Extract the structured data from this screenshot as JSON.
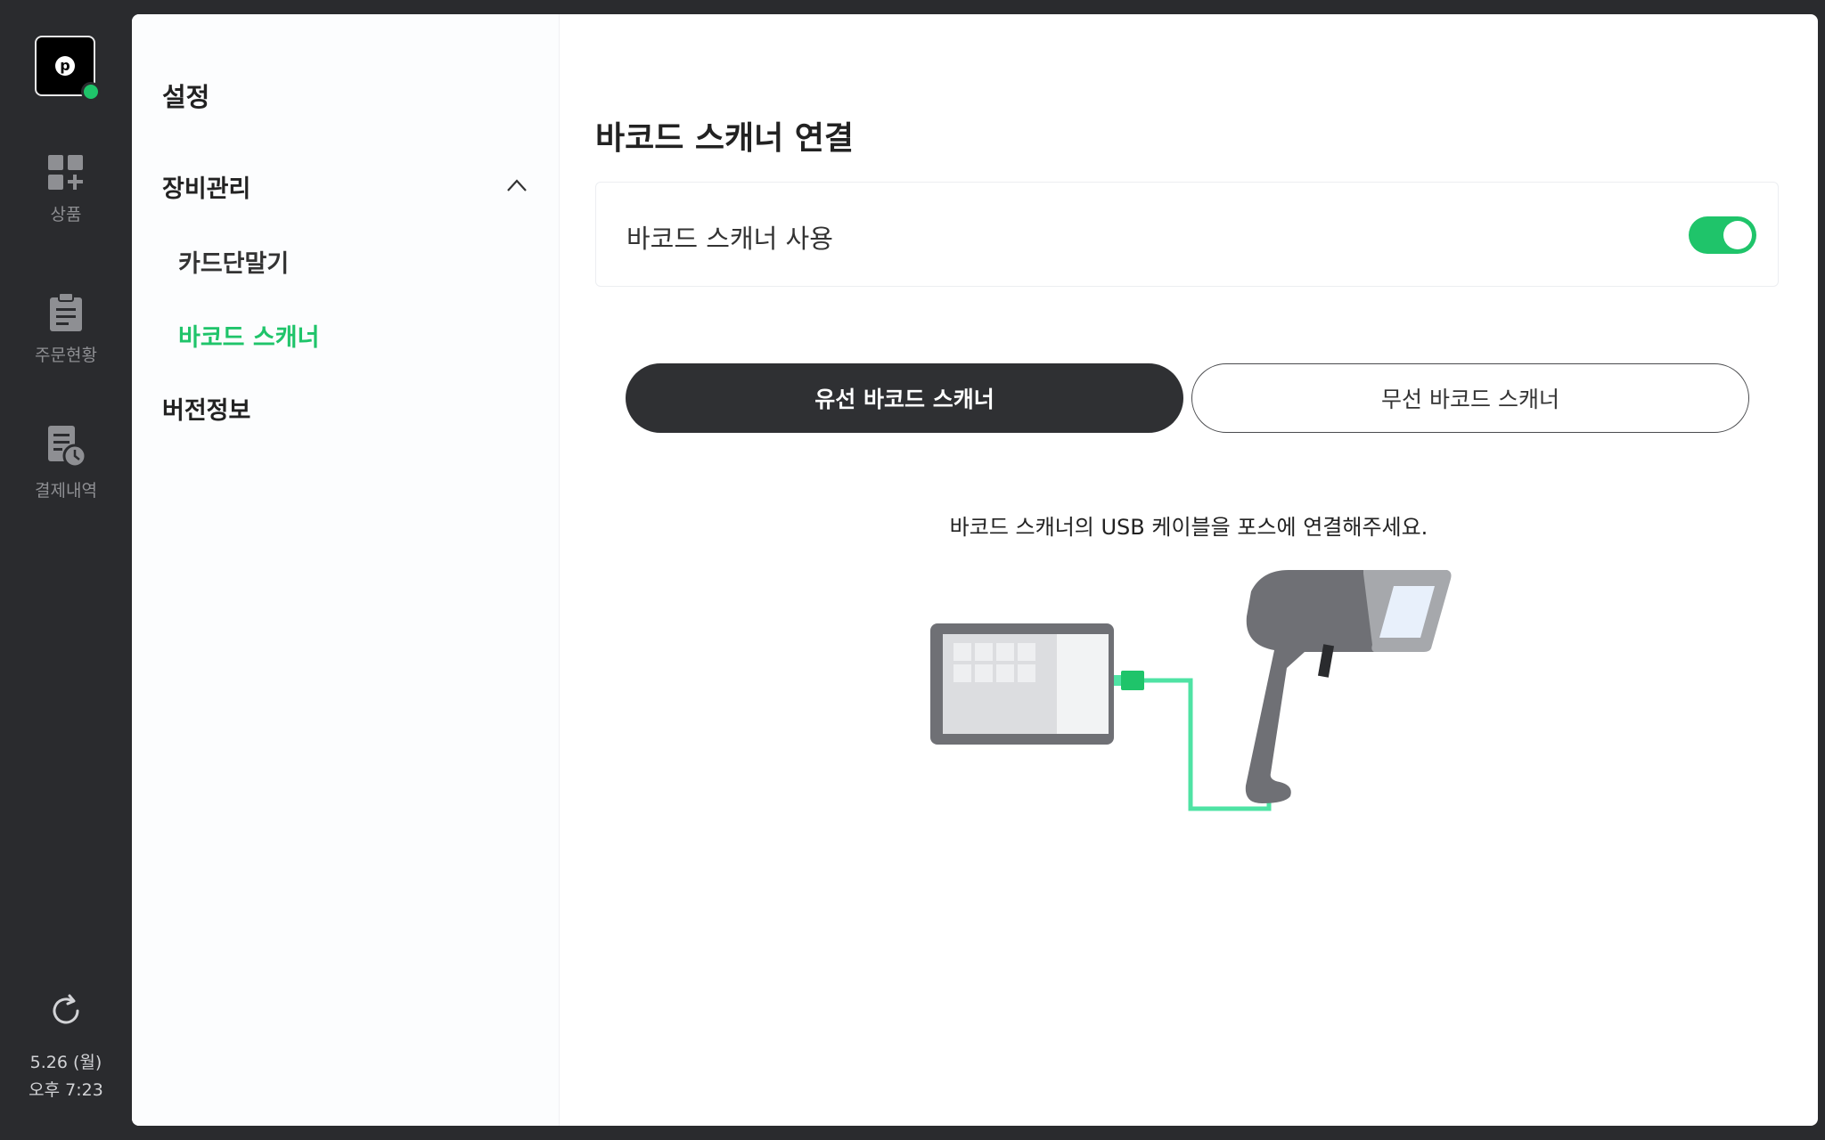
{
  "rail": {
    "items": [
      {
        "label": "상품",
        "icon": "grid-plus-icon"
      },
      {
        "label": "주문현황",
        "icon": "clipboard-icon"
      },
      {
        "label": "결제내역",
        "icon": "receipt-clock-icon"
      }
    ],
    "date": "5.26 (월)",
    "time": "오후 7:23",
    "logo_letter": "p"
  },
  "submenu": {
    "title": "설정",
    "group": "장비관리",
    "items": [
      {
        "label": "카드단말기",
        "active": false
      },
      {
        "label": "바코드 스캐너",
        "active": true
      }
    ],
    "version": "버전정보"
  },
  "content": {
    "title": "바코드 스캐너 연결",
    "toggle_label": "바코드 스캐너 사용",
    "toggle_on": true,
    "tabs": [
      "유선 바코드 스캐너",
      "무선 바코드 스캐너"
    ],
    "instruction": "바코드 스캐너의 USB 케이블을 포스에 연결해주세요."
  },
  "colors": {
    "accent": "#1fc46a",
    "rail_bg": "#2a2b2e",
    "cable": "#4fe3a4",
    "device": "#6f7075"
  }
}
